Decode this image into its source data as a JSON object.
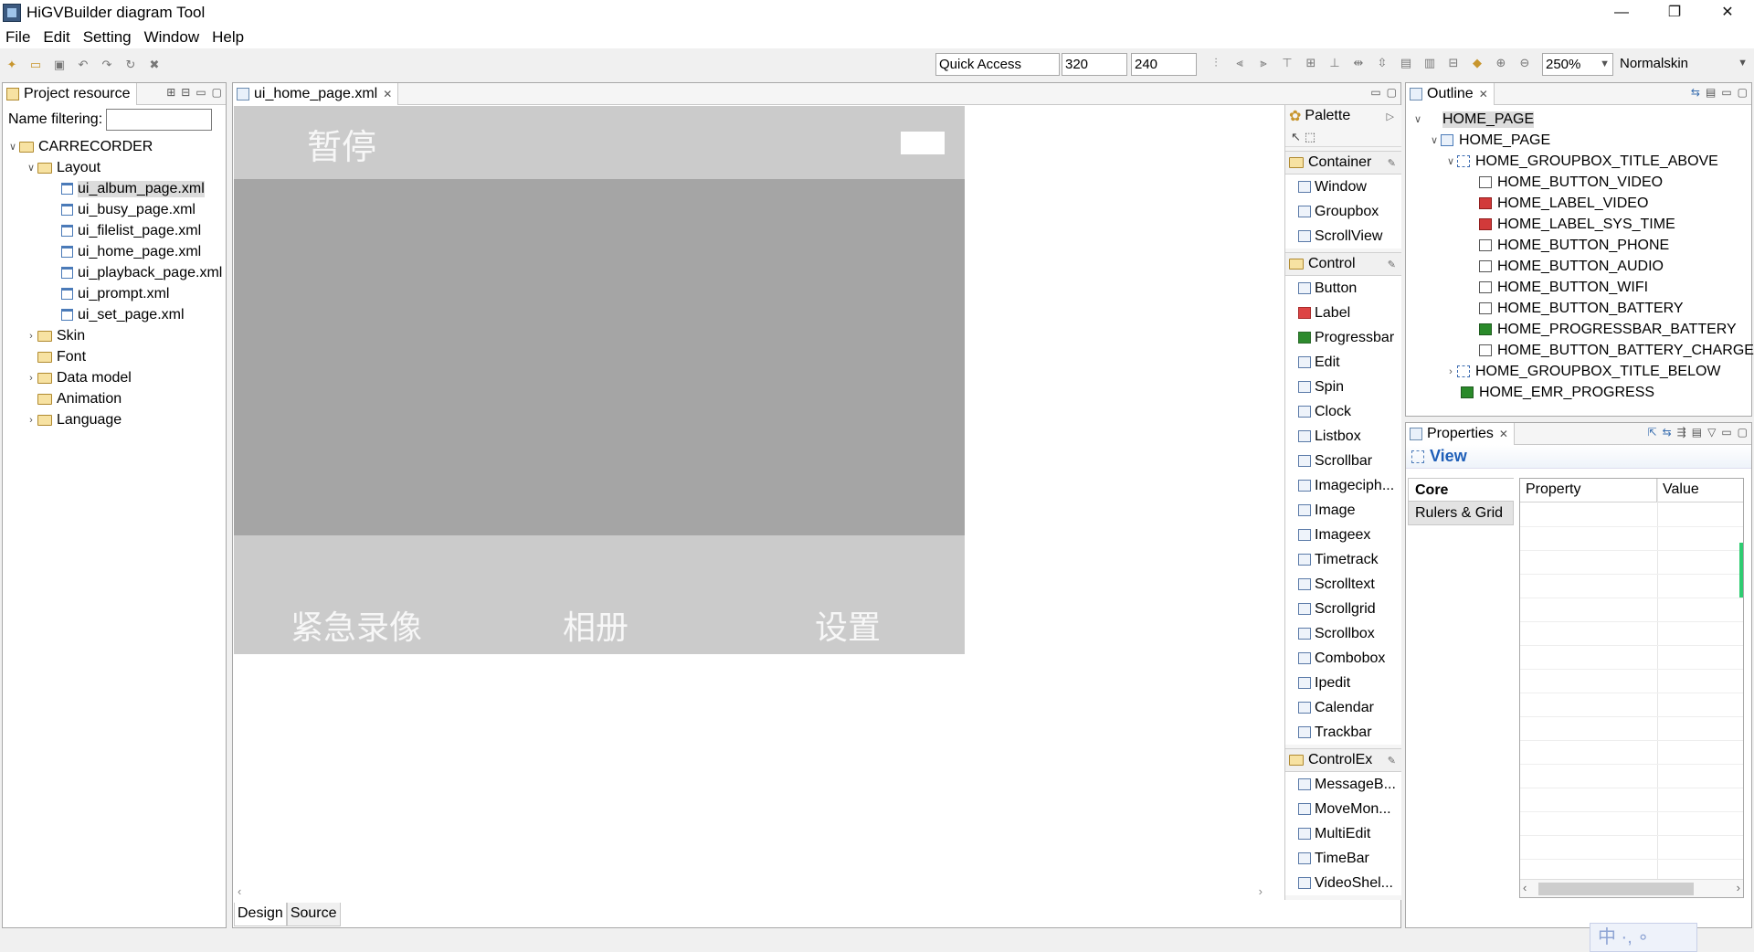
{
  "window": {
    "title": "HiGVBuilder diagram Tool",
    "min": "—",
    "restore": "❐",
    "close": "✕"
  },
  "menu": [
    "File",
    "Edit",
    "Setting",
    "Window",
    "Help"
  ],
  "toolbar": {
    "quick_access": "Quick Access",
    "width": "320",
    "height": "240",
    "zoom": "250%",
    "skin": "Normalskin"
  },
  "project": {
    "tab": "Project resource",
    "filter_label": "Name filtering:",
    "root": "CARRECORDER",
    "layout_folder": "Layout",
    "files": [
      "ui_album_page.xml",
      "ui_busy_page.xml",
      "ui_filelist_page.xml",
      "ui_home_page.xml",
      "ui_playback_page.xml",
      "ui_prompt.xml",
      "ui_set_page.xml"
    ],
    "folders": [
      "Skin",
      "Font",
      "Data model",
      "Animation",
      "Language"
    ]
  },
  "editor": {
    "tab": "ui_home_page.xml",
    "pause_text": "暂停",
    "labels": [
      "紧急录像",
      "相册",
      "设置"
    ],
    "bottom_tabs": [
      "Design",
      "Source"
    ]
  },
  "palette": {
    "title": "Palette",
    "groups": [
      {
        "name": "Container",
        "items": [
          "Window",
          "Groupbox",
          "ScrollView"
        ]
      },
      {
        "name": "Control",
        "items": [
          "Button",
          "Label",
          "Progressbar",
          "Edit",
          "Spin",
          "Clock",
          "Listbox",
          "Scrollbar",
          "Imageciph...",
          "Image",
          "Imageex",
          "Timetrack",
          "Scrolltext",
          "Scrollgrid",
          "Scrollbox",
          "Combobox",
          "Ipedit",
          "Calendar",
          "Trackbar"
        ]
      },
      {
        "name": "ControlEx",
        "items": [
          "MessageB...",
          "MoveMon...",
          "MultiEdit",
          "TimeBar",
          "VideoShel..."
        ]
      }
    ]
  },
  "outline": {
    "tab": "Outline",
    "root": "HOME_PAGE",
    "page": "HOME_PAGE",
    "group_above": "HOME_GROUPBOX_TITLE_ABOVE",
    "children": [
      {
        "name": "HOME_BUTTON_VIDEO",
        "kind": "btn"
      },
      {
        "name": "HOME_LABEL_VIDEO",
        "kind": "lbl"
      },
      {
        "name": "HOME_LABEL_SYS_TIME",
        "kind": "lbl"
      },
      {
        "name": "HOME_BUTTON_PHONE",
        "kind": "btn"
      },
      {
        "name": "HOME_BUTTON_AUDIO",
        "kind": "btn"
      },
      {
        "name": "HOME_BUTTON_WIFI",
        "kind": "btn"
      },
      {
        "name": "HOME_BUTTON_BATTERY",
        "kind": "btn"
      },
      {
        "name": "HOME_PROGRESSBAR_BATTERY",
        "kind": "prog"
      },
      {
        "name": "HOME_BUTTON_BATTERY_CHARGE",
        "kind": "btn"
      }
    ],
    "group_below": "HOME_GROUPBOX_TITLE_BELOW",
    "progress": "HOME_EMR_PROGRESS"
  },
  "properties": {
    "tab": "Properties",
    "view_title": "View",
    "sections": [
      "Core",
      "Rulers & Grid"
    ],
    "col_property": "Property",
    "col_value": "Value"
  },
  "ime": "中 ·, ∘"
}
